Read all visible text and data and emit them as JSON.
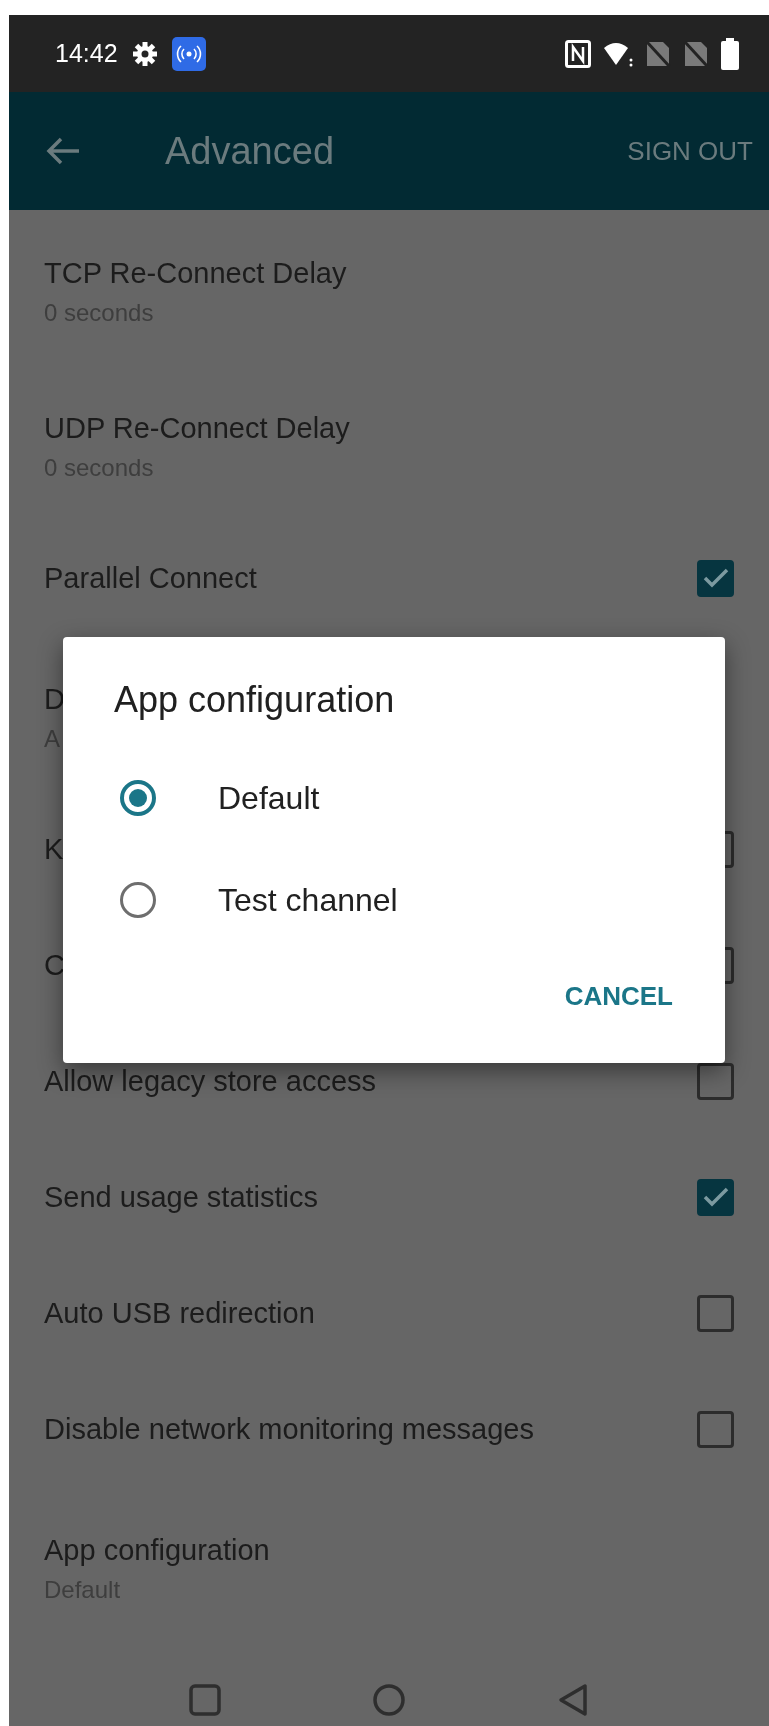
{
  "status_bar": {
    "time": "14:42"
  },
  "app_bar": {
    "title": "Advanced",
    "action": "SIGN OUT"
  },
  "settings": [
    {
      "kind": "value",
      "title": "TCP Re-Connect Delay",
      "summary": "0 seconds"
    },
    {
      "kind": "value",
      "title": "UDP Re-Connect Delay",
      "summary": "0 seconds"
    },
    {
      "kind": "checkbox",
      "title": "Parallel Connect",
      "checked": true
    },
    {
      "kind": "value",
      "title": "D",
      "summary": "A"
    },
    {
      "kind": "checkbox",
      "title": "K",
      "checked": false
    },
    {
      "kind": "checkbox",
      "title": "C",
      "checked": false
    },
    {
      "kind": "checkbox",
      "title": "Allow legacy store access",
      "checked": false
    },
    {
      "kind": "checkbox",
      "title": "Send usage statistics",
      "checked": true
    },
    {
      "kind": "checkbox",
      "title": "Auto USB redirection",
      "checked": false
    },
    {
      "kind": "checkbox",
      "title": "Disable network monitoring messages",
      "checked": false
    },
    {
      "kind": "value",
      "title": "App configuration",
      "summary": "Default"
    }
  ],
  "dialog": {
    "title": "App configuration",
    "options": [
      {
        "label": "Default",
        "selected": true
      },
      {
        "label": "Test channel",
        "selected": false
      }
    ],
    "button": "CANCEL"
  }
}
